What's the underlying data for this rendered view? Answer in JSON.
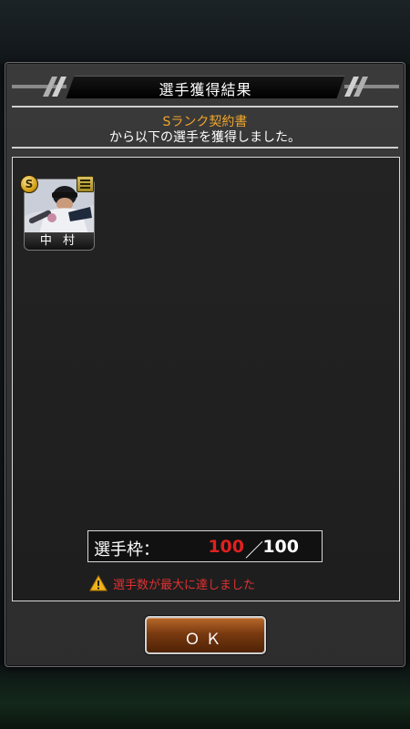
{
  "dialog": {
    "title": "選手獲得結果",
    "contract_name": "Sランク契約書",
    "message": "から以下の選手を獲得しました。"
  },
  "player_card": {
    "name": "中 村",
    "rank": "S",
    "rank_color": "#d4a017",
    "position_icon": "position-lines-icon"
  },
  "roster": {
    "label": "選手枠：",
    "current": "100",
    "separator": "／",
    "max": "100",
    "warning_icon": "warning-triangle-icon",
    "warning_text": "選手数が最大に達しました"
  },
  "ok_button": {
    "label": "ＯＫ"
  },
  "colors": {
    "contract_name": "#f0a52a",
    "count_full": "#e02020",
    "warning": "#e23030",
    "button": "#7a3a10"
  }
}
